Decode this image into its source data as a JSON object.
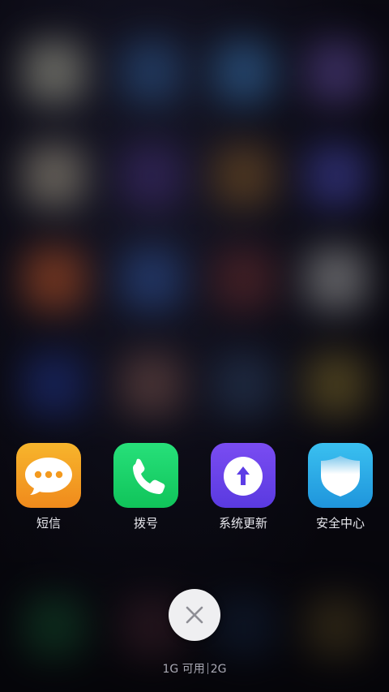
{
  "recent_apps": [
    {
      "name": "短信",
      "icon": "message-bubble-icon",
      "color": "#f5a623"
    },
    {
      "name": "拨号",
      "icon": "phone-icon",
      "color": "#1fd46a"
    },
    {
      "name": "系统更新",
      "icon": "update-arrow-icon",
      "color": "#6b46f0"
    },
    {
      "name": "安全中心",
      "icon": "shield-icon",
      "color": "#2aa7e8"
    }
  ],
  "close_button": {
    "icon": "close-icon"
  },
  "memory": {
    "available": "1G 可用",
    "total": "2G"
  },
  "colors": {
    "background": "#0d0c16",
    "close_button_bg": "#efeff1",
    "label_text": "#e8e8ee",
    "memory_text": "#a9a9b4"
  }
}
